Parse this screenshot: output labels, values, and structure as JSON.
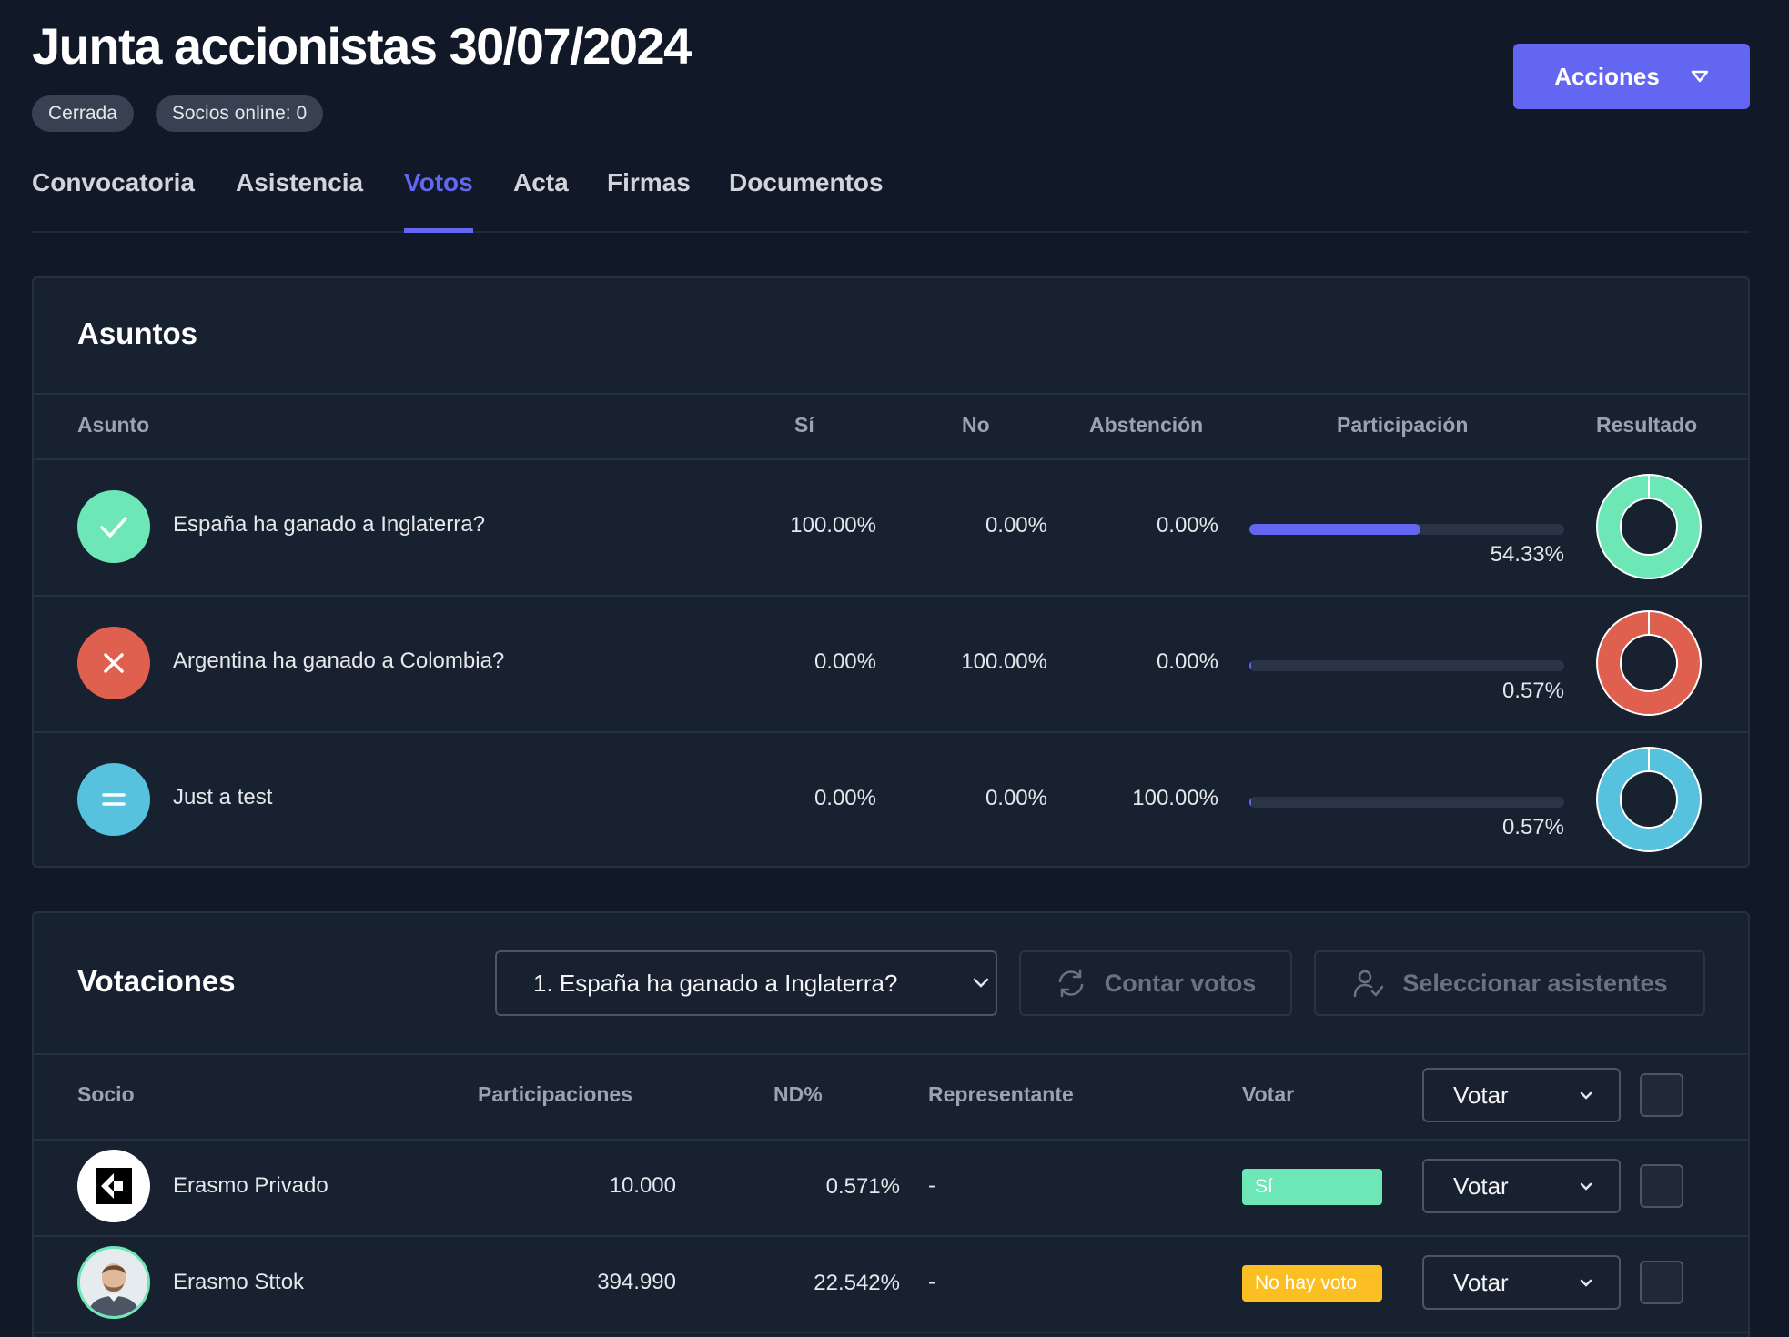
{
  "header": {
    "title": "Junta accionistas 30/07/2024",
    "badges": [
      "Cerrada",
      "Socios online: 0"
    ],
    "actions_label": "Acciones"
  },
  "tabs": [
    "Convocatoria",
    "Asistencia",
    "Votos",
    "Acta",
    "Firmas",
    "Documentos"
  ],
  "active_tab": "Votos",
  "asuntos": {
    "title": "Asuntos",
    "columns": [
      "Asunto",
      "Sí",
      "No",
      "Abstención",
      "Participación",
      "Resultado"
    ],
    "rows": [
      {
        "name": "España ha ganado a Inglaterra?",
        "si": "100.00%",
        "no": "0.00%",
        "abstencion": "0.00%",
        "participacion": "54.33%",
        "participacion_value": 54.33,
        "result": "approved",
        "color": "#6ee7b7"
      },
      {
        "name": "Argentina ha ganado a Colombia?",
        "si": "0.00%",
        "no": "100.00%",
        "abstencion": "0.00%",
        "participacion": "0.57%",
        "participacion_value": 0.57,
        "result": "rejected",
        "color": "#e0604f"
      },
      {
        "name": "Just a test",
        "si": "0.00%",
        "no": "0.00%",
        "abstencion": "100.00%",
        "participacion": "0.57%",
        "participacion_value": 0.57,
        "result": "abstention",
        "color": "#56c2de"
      }
    ]
  },
  "votaciones": {
    "title": "Votaciones",
    "selected_asunto": "1. España ha ganado a Inglaterra?",
    "count_label": "Contar votos",
    "select_label": "Seleccionar asistentes",
    "columns": [
      "Socio",
      "Participaciones",
      "ND%",
      "Representante",
      "Votar"
    ],
    "bulk_vote_label": "Votar",
    "rows": [
      {
        "socio": "Erasmo Privado",
        "participaciones": "10.000",
        "nd": "0.571%",
        "representante": "-",
        "voto": "Sí",
        "voto_color": "#6ee7b7",
        "vote_label": "Votar"
      },
      {
        "socio": "Erasmo Sttok",
        "participaciones": "394.990",
        "nd": "22.542%",
        "representante": "-",
        "voto": "No hay voto",
        "voto_color": "#fbbf24",
        "vote_label": "Votar"
      }
    ]
  },
  "colors": {
    "accent": "#6366f1",
    "background": "#111827",
    "card": "#182130"
  }
}
